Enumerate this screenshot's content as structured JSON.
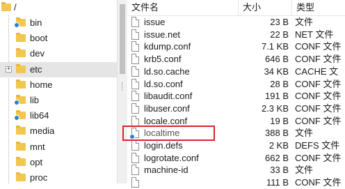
{
  "tree": {
    "root_label": "/",
    "items": [
      {
        "label": "bin",
        "symlink": true
      },
      {
        "label": "boot",
        "symlink": false
      },
      {
        "label": "dev",
        "symlink": false
      },
      {
        "label": "etc",
        "symlink": false,
        "selected": true,
        "expander": "+"
      },
      {
        "label": "home",
        "symlink": false
      },
      {
        "label": "lib",
        "symlink": true
      },
      {
        "label": "lib64",
        "symlink": true
      },
      {
        "label": "media",
        "symlink": false
      },
      {
        "label": "mnt",
        "symlink": false
      },
      {
        "label": "opt",
        "symlink": false
      },
      {
        "label": "proc",
        "symlink": false
      }
    ]
  },
  "list": {
    "headers": {
      "name": "文件名",
      "size": "大小",
      "type": "类型"
    },
    "rows": [
      {
        "name": "issue",
        "size": "23 B",
        "type": "文件"
      },
      {
        "name": "issue.net",
        "size": "22 B",
        "type": "NET 文件"
      },
      {
        "name": "kdump.conf",
        "size": "7.1 KB",
        "type": "CONF 文件"
      },
      {
        "name": "krb5.conf",
        "size": "646 B",
        "type": "CONF 文件"
      },
      {
        "name": "ld.so.cache",
        "size": "34 KB",
        "type": "CACHE 文"
      },
      {
        "name": "ld.so.conf",
        "size": "28 B",
        "type": "CONF 文件"
      },
      {
        "name": "libaudit.conf",
        "size": "191 B",
        "type": "CONF 文件"
      },
      {
        "name": "libuser.conf",
        "size": "2.3 KB",
        "type": "CONF 文件"
      },
      {
        "name": "locale.conf",
        "size": "19 B",
        "type": "CONF 文件"
      },
      {
        "name": "localtime",
        "size": "388 B",
        "type": "文件",
        "symlink": true,
        "highlighted": true
      },
      {
        "name": "login.defs",
        "size": "2 KB",
        "type": "DEFS 文件"
      },
      {
        "name": "logrotate.conf",
        "size": "662 B",
        "type": "CONF 文件"
      },
      {
        "name": "machine-id",
        "size": "33 B",
        "type": "文件"
      },
      {
        "name": "",
        "size": "111 B",
        "type": "CONF 文件"
      }
    ]
  },
  "colors": {
    "highlight_border": "#d9232d",
    "folder": "#f2c750",
    "symlink_arrow": "#2f7fd1"
  }
}
